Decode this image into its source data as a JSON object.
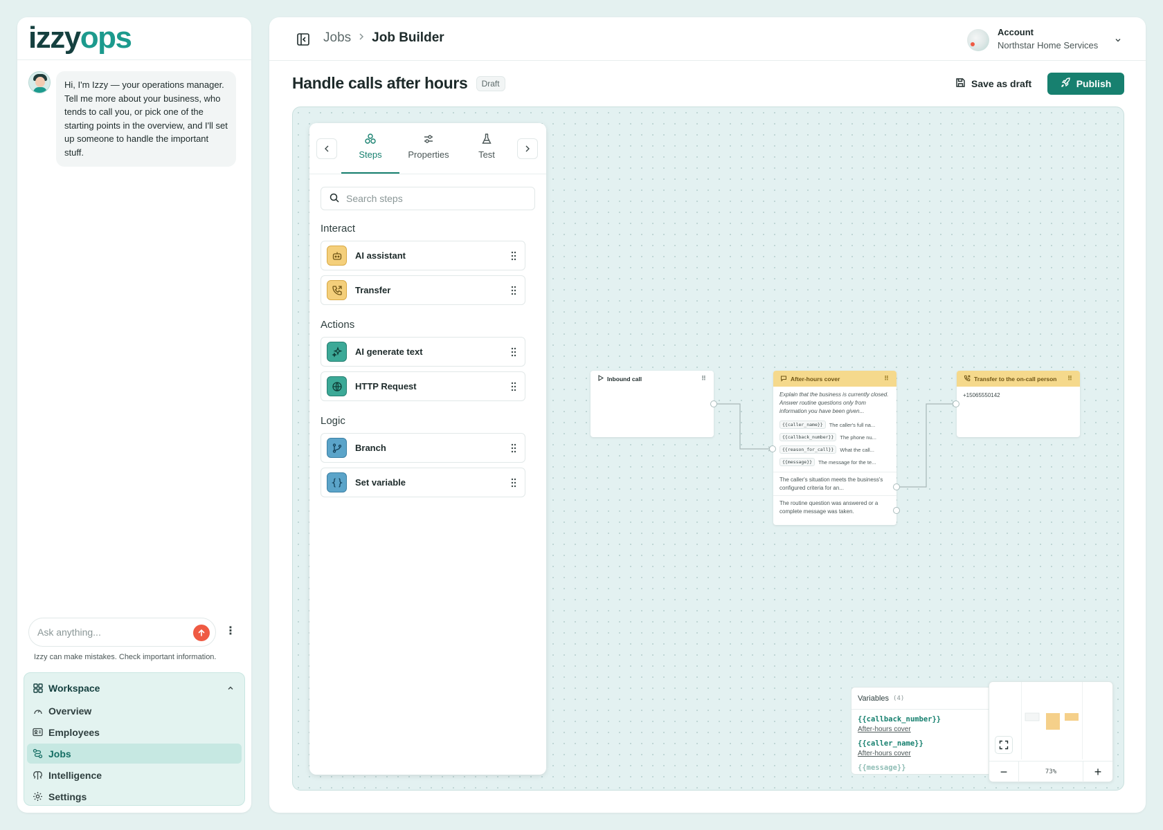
{
  "brand": {
    "part1": "izzy",
    "part2": "ops"
  },
  "assistant": {
    "message": "Hi, I'm Izzy — your operations manager. Tell me more about your business, who tends to call you, or pick one of the starting points in the overview, and I'll set up someone to handle the important stuff.",
    "input_placeholder": "Ask anything...",
    "disclaimer": "Izzy can make mistakes. Check important information."
  },
  "nav": {
    "section": "Workspace",
    "items": [
      {
        "label": "Overview",
        "icon": "gauge-icon"
      },
      {
        "label": "Employees",
        "icon": "id-card-icon"
      },
      {
        "label": "Jobs",
        "icon": "route-icon",
        "active": true
      },
      {
        "label": "Intelligence",
        "icon": "brain-icon"
      },
      {
        "label": "Settings",
        "icon": "gear-icon"
      }
    ]
  },
  "header": {
    "breadcrumb": [
      "Jobs",
      "Job Builder"
    ],
    "account_label": "Account",
    "account_name": "Northstar Home Services"
  },
  "job": {
    "title": "Handle calls after hours",
    "status": "Draft",
    "save_label": "Save as draft",
    "publish_label": "Publish"
  },
  "panel": {
    "tabs": [
      "Steps",
      "Properties",
      "Test"
    ],
    "active_tab": "Steps",
    "search_placeholder": "Search steps",
    "groups": [
      {
        "name": "Interact",
        "steps": [
          "AI assistant",
          "Transfer"
        ]
      },
      {
        "name": "Actions",
        "steps": [
          "AI generate text",
          "HTTP Request"
        ]
      },
      {
        "name": "Logic",
        "steps": [
          "Branch",
          "Set variable"
        ]
      }
    ]
  },
  "nodes": {
    "inbound": {
      "title": "Inbound call"
    },
    "after_hours": {
      "title": "After-hours cover",
      "description": "Explain that the business is currently closed. Answer routine questions only from information you have been given...",
      "variables": [
        {
          "name": "{{caller_name}}",
          "desc": "The caller's full na..."
        },
        {
          "name": "{{callback_number}}",
          "desc": "The phone nu..."
        },
        {
          "name": "{{reason_for_call}}",
          "desc": "What the call..."
        },
        {
          "name": "{{message}}",
          "desc": "The message for the te..."
        }
      ],
      "outputs": [
        "The caller's situation meets the business's configured criteria for an...",
        "The routine question was answered or a complete message was taken."
      ]
    },
    "transfer": {
      "title": "Transfer to the on-call person",
      "number": "+15065550142"
    }
  },
  "variables_panel": {
    "title": "Variables",
    "count": "(4)",
    "items": [
      {
        "name": "{{callback_number}}",
        "source": "After-hours cover"
      },
      {
        "name": "{{caller_name}}",
        "source": "After-hours cover"
      },
      {
        "name": "{{message}}",
        "source": ""
      }
    ]
  },
  "minimap": {
    "zoom": "73%",
    "zoom_out": "−",
    "zoom_in": "+"
  },
  "colors": {
    "accent": "#17806f",
    "brand_dark": "#15403f",
    "brand_teal": "#1c9a8d",
    "send": "#ef5a43",
    "node_header": "#f5d98c"
  }
}
